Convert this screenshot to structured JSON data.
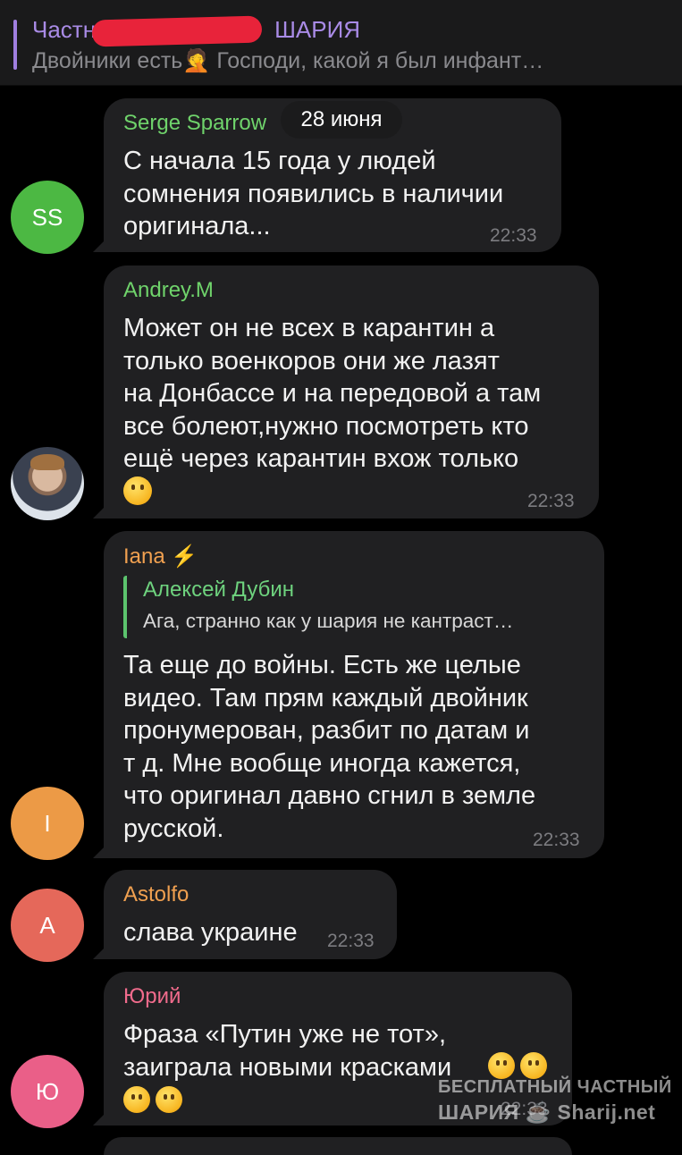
{
  "pinned": {
    "title_left": "Частн",
    "title_right": "ШАРИЯ",
    "text": "Двойники есть🤦 Господи, какой я был инфант…"
  },
  "date_pill": "28 июня",
  "messages": [
    {
      "avatar_initials": "SS",
      "avatar_color": "#4cb843",
      "sender": "Serge Sparrow",
      "sender_color": "#6fd36b",
      "text": "С начала 15 года у людей\nсомнения появились в наличии\nоригинала...",
      "time": "22:33"
    },
    {
      "avatar_initials": "",
      "sender": "Andrey.M",
      "sender_color": "#6fd36b",
      "text": "Может он не всех в карантин а\nтолько военкоров они же лазят\nна Донбассе и на передовой а там\nвсе болеют,нужно посмотреть кто\nещё через карантин вхож только",
      "emoji": "thinking-face",
      "time": "22:33"
    },
    {
      "avatar_initials": "I",
      "avatar_color": "#ec9a46",
      "sender": "Iana ⚡",
      "sender_color": "#f0a050",
      "reply_name": "Алексей Дубин",
      "reply_text": "Ага, странно как у шария не кантраст…",
      "text": "Та еще до войны. Есть же целые\nвидео. Там прям каждый двойник\nпронумерован, разбит по датам и\nт д. Мне вообще иногда кажется,\nчто оригинал давно сгнил в земле\nрусской.",
      "time": "22:33"
    },
    {
      "avatar_initials": "A",
      "avatar_color": "#e5685a",
      "sender": "Astolfo",
      "sender_color": "#f0a050",
      "text": "слава украине",
      "time": "22:33"
    },
    {
      "avatar_initials": "Ю",
      "avatar_color": "#ea5f88",
      "sender": "Юрий",
      "sender_color": "#f06b8c",
      "text": "Фраза «Путин уже не тот»,\nзаиграла новыми красками",
      "emojis": [
        "hand-over-mouth",
        "tears-of-joy",
        "hand-over-mouth",
        "hand-over-mouth"
      ],
      "time": "22:33"
    }
  ],
  "watermark": {
    "line1": "БЕСПЛАТНЫЙ ЧАСТНЫЙ",
    "line2": "ШАРИЯ ☕ Sharij.net"
  }
}
